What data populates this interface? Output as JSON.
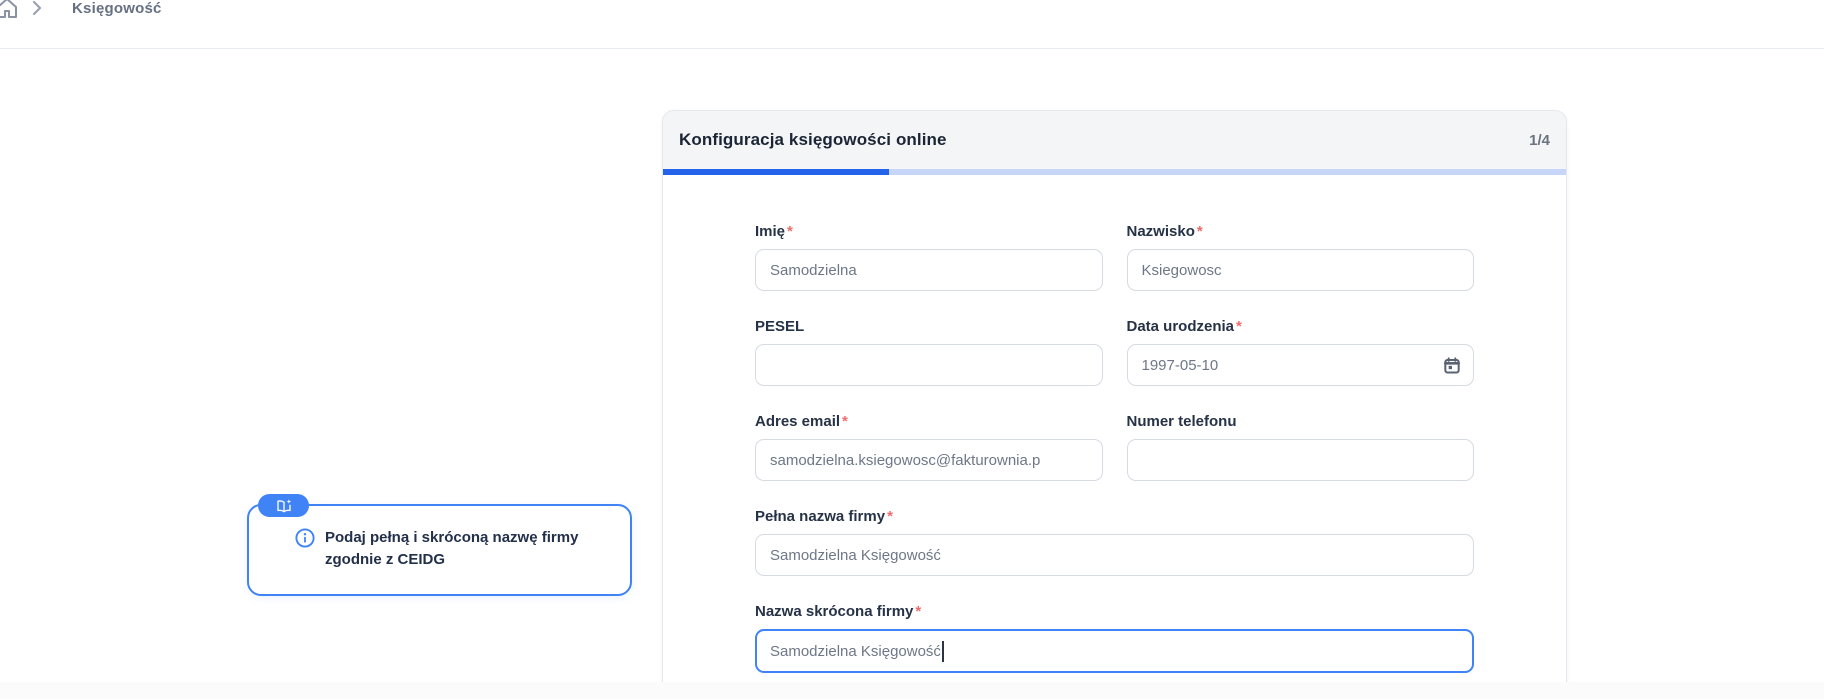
{
  "breadcrumb": {
    "item": "Księgowość"
  },
  "wizard": {
    "title": "Konfiguracja księgowości online",
    "step_indicator": "1/4",
    "progress_percent": 25,
    "colors": {
      "progress_fill": "#2563eb",
      "progress_track": "#c7d6f8",
      "accent": "#3f83f7",
      "required_marker": "#ef6a6a"
    }
  },
  "form": {
    "fields": {
      "first_name": {
        "label": "Imię",
        "required": "*",
        "value": "Samodzielna"
      },
      "last_name": {
        "label": "Nazwisko",
        "required": "*",
        "value": "Ksiegowosc"
      },
      "pesel": {
        "label": "PESEL",
        "value": ""
      },
      "birth_date": {
        "label": "Data urodzenia",
        "required": "*",
        "value": "1997-05-10"
      },
      "email": {
        "label": "Adres email",
        "required": "*",
        "value": "samodzielna.ksiegowosc@fakturownia.p"
      },
      "phone": {
        "label": "Numer telefonu",
        "value": ""
      },
      "company_full_name": {
        "label": "Pełna nazwa firmy",
        "required": "*",
        "value": "Samodzielna Księgowość"
      },
      "company_short_name": {
        "label": "Nazwa skrócona firmy",
        "required": "*",
        "value": "Samodzielna Księgowość"
      }
    }
  },
  "tooltip": {
    "line1": "Podaj pełną i skróconą nazwę firmy",
    "line2": "zgodnie z CEIDG",
    "icons": {
      "badge": "book-sparkle-icon",
      "inline": "info-icon"
    }
  }
}
